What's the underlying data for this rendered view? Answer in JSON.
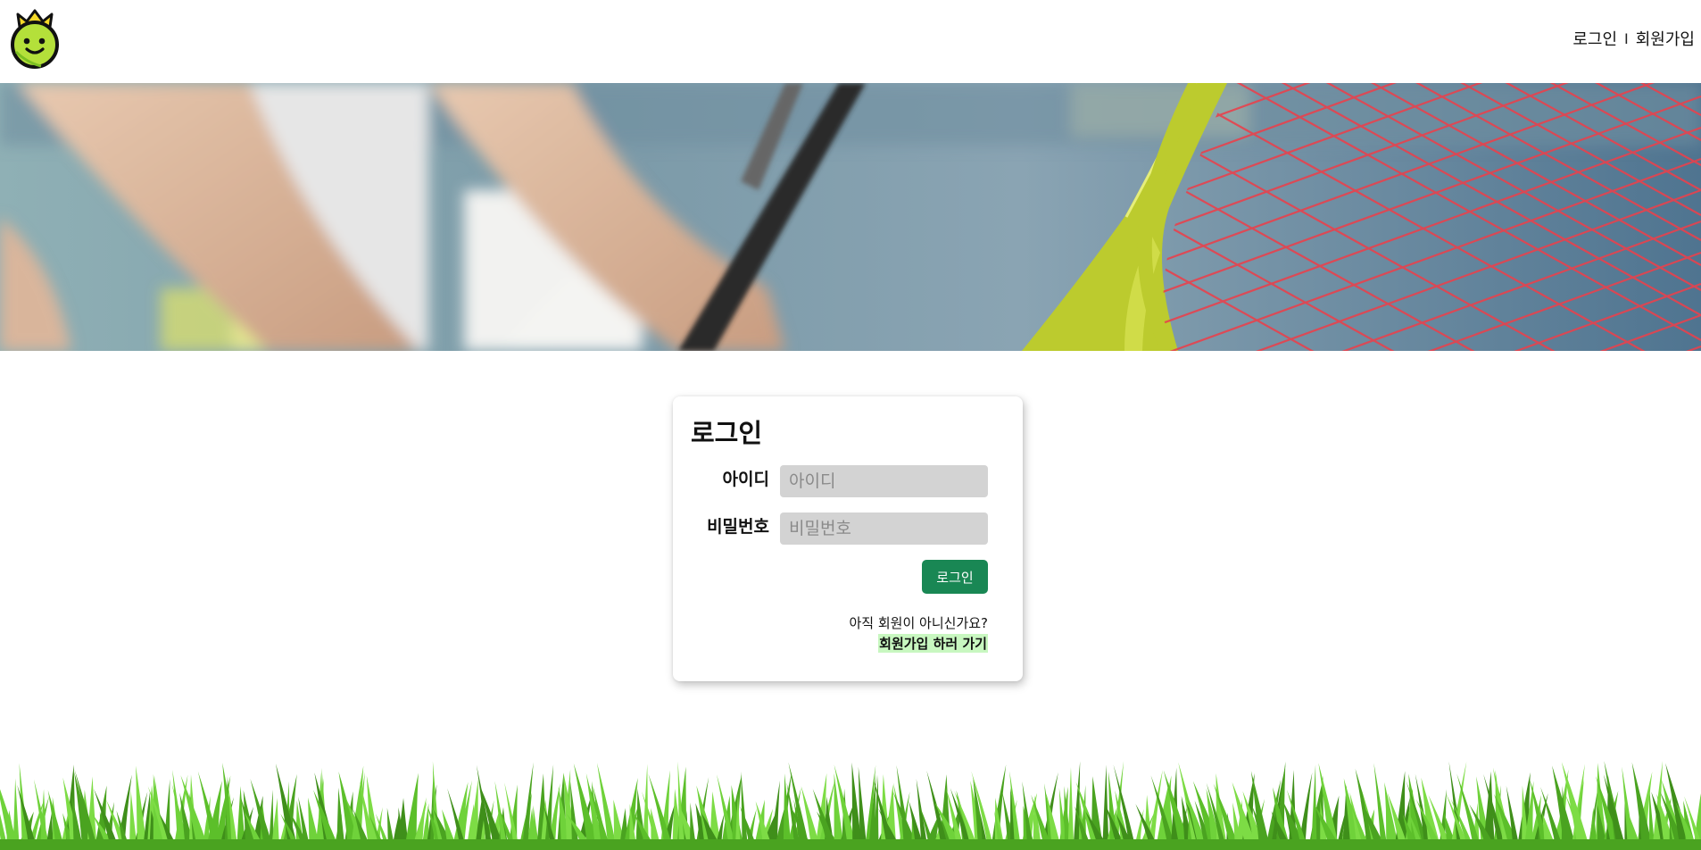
{
  "header": {
    "logo_icon": "tennis-ball-king-icon",
    "nav": {
      "login": "로그인",
      "separator": "I",
      "signup": "회원가입"
    }
  },
  "banner": {
    "image": "tennis-racket-banner"
  },
  "login": {
    "title": "로그인",
    "id_label": "아이디",
    "id_placeholder": "아이디",
    "id_value": "",
    "password_label": "비밀번호",
    "password_placeholder": "비밀번호",
    "password_value": "",
    "submit_label": "로그인",
    "signup_prompt": "아직 회원이 아니신가요?",
    "signup_link": "회원가입 하러 가기"
  },
  "colors": {
    "primary_button": "#198754",
    "input_bg": "#d3d3d3",
    "link_highlight": "#c8f7c0",
    "grass": "#5cbf2a"
  }
}
